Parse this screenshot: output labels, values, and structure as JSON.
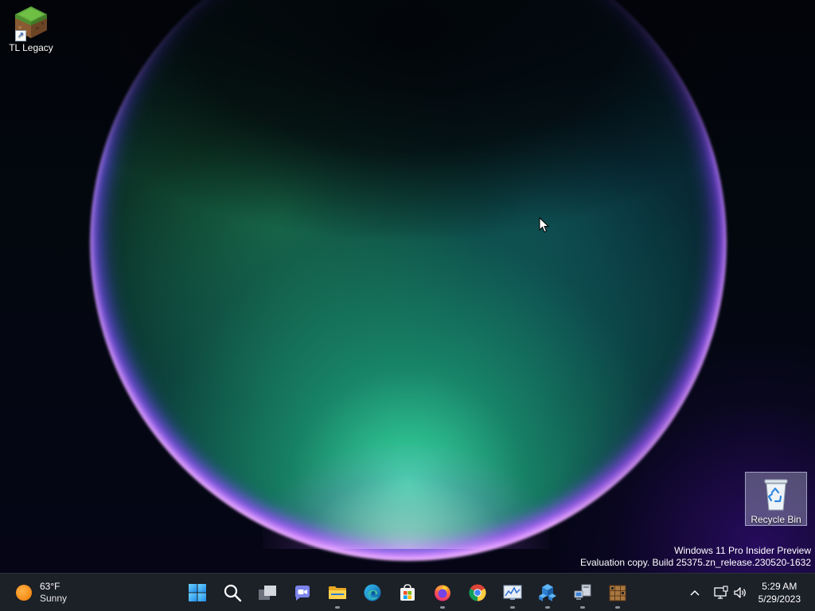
{
  "desktop": {
    "icons": [
      {
        "label": "TL Legacy"
      },
      {
        "label": "Recycle Bin"
      }
    ],
    "watermark": {
      "line1": "Windows 11 Pro Insider Preview",
      "line2": "Evaluation copy. Build 25375.zn_release.230520-1632"
    }
  },
  "taskbar": {
    "weather": {
      "temp": "63°F",
      "condition": "Sunny",
      "icon": "sun-icon"
    },
    "apps": [
      {
        "name": "start-button",
        "icon": "windows-logo-icon"
      },
      {
        "name": "search-button",
        "icon": "search-icon"
      },
      {
        "name": "task-view-button",
        "icon": "task-view-icon"
      },
      {
        "name": "teams-chat-button",
        "icon": "teams-chat-icon"
      },
      {
        "name": "file-explorer-button",
        "icon": "folder-icon"
      },
      {
        "name": "edge-button",
        "icon": "edge-icon"
      },
      {
        "name": "microsoft-store-button",
        "icon": "store-icon"
      },
      {
        "name": "firefox-button",
        "icon": "firefox-icon"
      },
      {
        "name": "chrome-button",
        "icon": "chrome-icon"
      },
      {
        "name": "resource-monitor-button",
        "icon": "monitor-chart-icon"
      },
      {
        "name": "app-blue-cube-button",
        "icon": "blue-cubes-icon"
      },
      {
        "name": "app-network-button",
        "icon": "network-computers-icon"
      },
      {
        "name": "app-crate-button",
        "icon": "wooden-crate-icon"
      }
    ],
    "clock": {
      "time": "5:29 AM",
      "date": "5/29/2023"
    }
  },
  "colors": {
    "taskbar_bg": "#1c2027",
    "accent": "#0078d4",
    "text": "#ffffff"
  }
}
